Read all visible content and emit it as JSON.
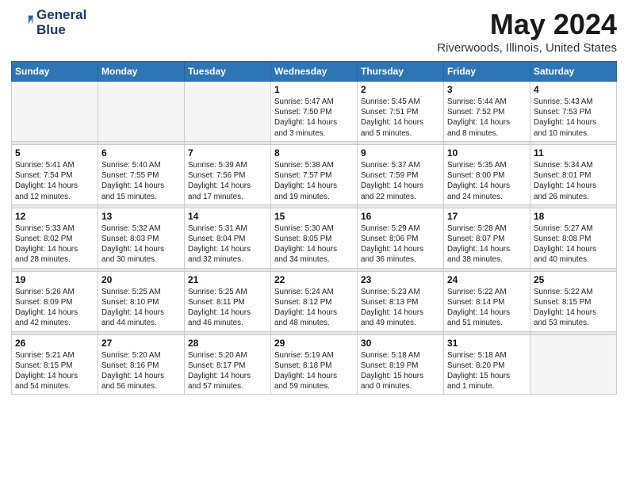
{
  "header": {
    "logo_line1": "General",
    "logo_line2": "Blue",
    "main_title": "May 2024",
    "subtitle": "Riverwoods, Illinois, United States"
  },
  "weekdays": [
    "Sunday",
    "Monday",
    "Tuesday",
    "Wednesday",
    "Thursday",
    "Friday",
    "Saturday"
  ],
  "weeks": [
    [
      {
        "day": "",
        "info": ""
      },
      {
        "day": "",
        "info": ""
      },
      {
        "day": "",
        "info": ""
      },
      {
        "day": "1",
        "info": "Sunrise: 5:47 AM\nSunset: 7:50 PM\nDaylight: 14 hours\nand 3 minutes."
      },
      {
        "day": "2",
        "info": "Sunrise: 5:45 AM\nSunset: 7:51 PM\nDaylight: 14 hours\nand 5 minutes."
      },
      {
        "day": "3",
        "info": "Sunrise: 5:44 AM\nSunset: 7:52 PM\nDaylight: 14 hours\nand 8 minutes."
      },
      {
        "day": "4",
        "info": "Sunrise: 5:43 AM\nSunset: 7:53 PM\nDaylight: 14 hours\nand 10 minutes."
      }
    ],
    [
      {
        "day": "5",
        "info": "Sunrise: 5:41 AM\nSunset: 7:54 PM\nDaylight: 14 hours\nand 12 minutes."
      },
      {
        "day": "6",
        "info": "Sunrise: 5:40 AM\nSunset: 7:55 PM\nDaylight: 14 hours\nand 15 minutes."
      },
      {
        "day": "7",
        "info": "Sunrise: 5:39 AM\nSunset: 7:56 PM\nDaylight: 14 hours\nand 17 minutes."
      },
      {
        "day": "8",
        "info": "Sunrise: 5:38 AM\nSunset: 7:57 PM\nDaylight: 14 hours\nand 19 minutes."
      },
      {
        "day": "9",
        "info": "Sunrise: 5:37 AM\nSunset: 7:59 PM\nDaylight: 14 hours\nand 22 minutes."
      },
      {
        "day": "10",
        "info": "Sunrise: 5:35 AM\nSunset: 8:00 PM\nDaylight: 14 hours\nand 24 minutes."
      },
      {
        "day": "11",
        "info": "Sunrise: 5:34 AM\nSunset: 8:01 PM\nDaylight: 14 hours\nand 26 minutes."
      }
    ],
    [
      {
        "day": "12",
        "info": "Sunrise: 5:33 AM\nSunset: 8:02 PM\nDaylight: 14 hours\nand 28 minutes."
      },
      {
        "day": "13",
        "info": "Sunrise: 5:32 AM\nSunset: 8:03 PM\nDaylight: 14 hours\nand 30 minutes."
      },
      {
        "day": "14",
        "info": "Sunrise: 5:31 AM\nSunset: 8:04 PM\nDaylight: 14 hours\nand 32 minutes."
      },
      {
        "day": "15",
        "info": "Sunrise: 5:30 AM\nSunset: 8:05 PM\nDaylight: 14 hours\nand 34 minutes."
      },
      {
        "day": "16",
        "info": "Sunrise: 5:29 AM\nSunset: 8:06 PM\nDaylight: 14 hours\nand 36 minutes."
      },
      {
        "day": "17",
        "info": "Sunrise: 5:28 AM\nSunset: 8:07 PM\nDaylight: 14 hours\nand 38 minutes."
      },
      {
        "day": "18",
        "info": "Sunrise: 5:27 AM\nSunset: 8:08 PM\nDaylight: 14 hours\nand 40 minutes."
      }
    ],
    [
      {
        "day": "19",
        "info": "Sunrise: 5:26 AM\nSunset: 8:09 PM\nDaylight: 14 hours\nand 42 minutes."
      },
      {
        "day": "20",
        "info": "Sunrise: 5:25 AM\nSunset: 8:10 PM\nDaylight: 14 hours\nand 44 minutes."
      },
      {
        "day": "21",
        "info": "Sunrise: 5:25 AM\nSunset: 8:11 PM\nDaylight: 14 hours\nand 46 minutes."
      },
      {
        "day": "22",
        "info": "Sunrise: 5:24 AM\nSunset: 8:12 PM\nDaylight: 14 hours\nand 48 minutes."
      },
      {
        "day": "23",
        "info": "Sunrise: 5:23 AM\nSunset: 8:13 PM\nDaylight: 14 hours\nand 49 minutes."
      },
      {
        "day": "24",
        "info": "Sunrise: 5:22 AM\nSunset: 8:14 PM\nDaylight: 14 hours\nand 51 minutes."
      },
      {
        "day": "25",
        "info": "Sunrise: 5:22 AM\nSunset: 8:15 PM\nDaylight: 14 hours\nand 53 minutes."
      }
    ],
    [
      {
        "day": "26",
        "info": "Sunrise: 5:21 AM\nSunset: 8:15 PM\nDaylight: 14 hours\nand 54 minutes."
      },
      {
        "day": "27",
        "info": "Sunrise: 5:20 AM\nSunset: 8:16 PM\nDaylight: 14 hours\nand 56 minutes."
      },
      {
        "day": "28",
        "info": "Sunrise: 5:20 AM\nSunset: 8:17 PM\nDaylight: 14 hours\nand 57 minutes."
      },
      {
        "day": "29",
        "info": "Sunrise: 5:19 AM\nSunset: 8:18 PM\nDaylight: 14 hours\nand 59 minutes."
      },
      {
        "day": "30",
        "info": "Sunrise: 5:18 AM\nSunset: 8:19 PM\nDaylight: 15 hours\nand 0 minutes."
      },
      {
        "day": "31",
        "info": "Sunrise: 5:18 AM\nSunset: 8:20 PM\nDaylight: 15 hours\nand 1 minute."
      },
      {
        "day": "",
        "info": ""
      }
    ]
  ]
}
